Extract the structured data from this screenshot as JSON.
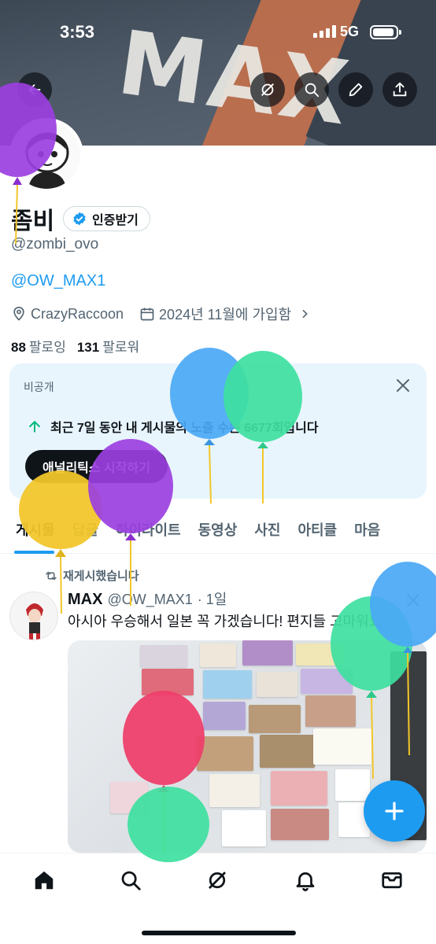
{
  "status_bar": {
    "time": "3:53",
    "network": "5G"
  },
  "banner": {
    "text": "MAX"
  },
  "profile": {
    "name": "좀비",
    "verify_label": "인증받기",
    "handle": "@zombi_ovo",
    "bio_link": "@OW_MAX1",
    "location": "CrazyRaccoon",
    "joined": "2024년 11월에 가입함",
    "following_count": "88",
    "following_label": "팔로잉",
    "followers_count": "131",
    "followers_label": "팔로워"
  },
  "analytics_card": {
    "private_label": "비공개",
    "headline": "최근 7일 동안 내 게시물의 노출 수는 6677회입니다",
    "cta_label": "애널리틱스 시작하기"
  },
  "tabs": [
    {
      "label": "게시물"
    },
    {
      "label": "답글"
    },
    {
      "label": "하이라이트"
    },
    {
      "label": "동영상"
    },
    {
      "label": "사진"
    },
    {
      "label": "아티클"
    },
    {
      "label": "마음"
    }
  ],
  "post": {
    "repost_label": "재게시했습니다",
    "author_name": "MAX",
    "author_handle": "@OW_MAX1",
    "time": "· 1일",
    "text": "아시아 우승해서 일본 꼭 가겠습니다! 편지들 고마워요!"
  },
  "colors": {
    "accent": "#1d9bf0",
    "text_primary": "#0f1419",
    "text_secondary": "#536471",
    "card_bg": "#e8f5fd",
    "balloon_purple": "#9b3fe0",
    "balloon_blue": "#4aa8f5",
    "balloon_green": "#3ee0a0",
    "balloon_yellow": "#f2c62a",
    "balloon_pink": "#ee3f6a"
  },
  "icons": {
    "back": "arrow-left-icon",
    "grok": "grok-icon",
    "search": "search-icon",
    "edit": "pencil-icon",
    "share": "share-icon",
    "location": "location-pin-icon",
    "calendar": "calendar-icon",
    "close": "close-icon",
    "growth": "arrow-up-icon",
    "repost": "repost-icon",
    "compose": "plus-icon",
    "home": "home-icon",
    "notifications": "bell-icon",
    "messages": "mail-icon"
  }
}
